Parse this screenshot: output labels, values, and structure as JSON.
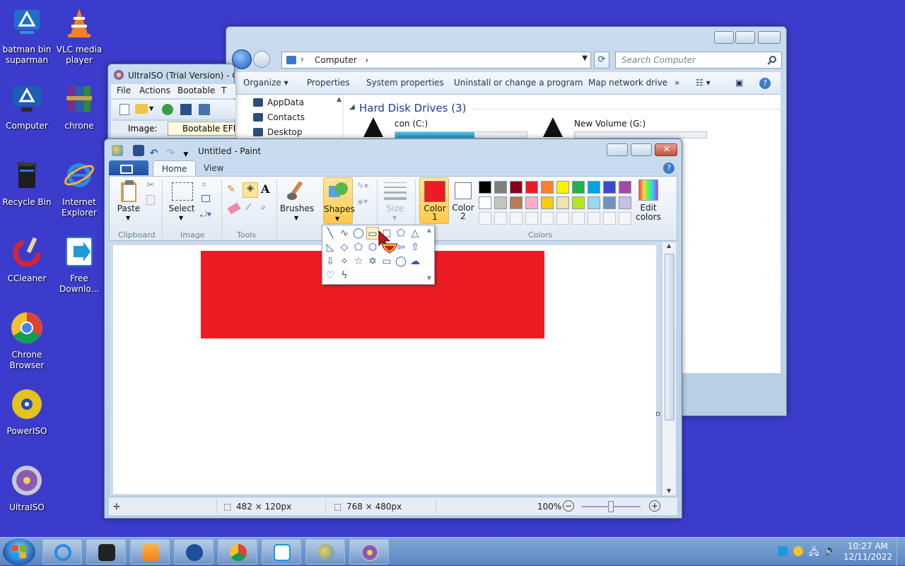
{
  "desktop": {
    "icons": [
      {
        "label": "batman bin\nsuparman",
        "icon": "computer-logo-icon"
      },
      {
        "label": "VLC media\nplayer",
        "icon": "vlc-cone-icon"
      },
      {
        "label": "Computer",
        "icon": "computer-logo-icon"
      },
      {
        "label": "chrone",
        "icon": "winrar-books-icon"
      },
      {
        "label": "Recycle Bin",
        "icon": "recycle-bin-icon"
      },
      {
        "label": "Internet\nExplorer",
        "icon": "internet-explorer-icon"
      },
      {
        "label": "CCleaner",
        "icon": "ccleaner-icon"
      },
      {
        "label": "Free\nDownlo...",
        "icon": "free-download-icon"
      },
      {
        "label": "Chrone\nBrowser",
        "icon": "chrome-icon"
      },
      {
        "label": "PowerISO",
        "icon": "poweriso-disc-icon"
      },
      {
        "label": "UltraISO",
        "icon": "ultraiso-disc-icon"
      }
    ]
  },
  "explorer": {
    "address": "Computer",
    "search_placeholder": "Search Computer",
    "toolbar": [
      "Organize",
      "Properties",
      "System properties",
      "Uninstall or change a program",
      "Map network drive",
      "»"
    ],
    "nav_items": [
      "AppData",
      "Contacts",
      "Desktop"
    ],
    "section_title": "Hard Disk Drives (3)",
    "drives": [
      {
        "name": "con (C:)",
        "fill": 0.6
      },
      {
        "name": "New Volume (G:)",
        "fill": 0.0
      }
    ]
  },
  "ultraiso": {
    "title": "UltraISO (Trial Version) - C",
    "menu": [
      "File",
      "Actions",
      "Bootable",
      "T"
    ],
    "image_label": "Image:",
    "image_value": "Bootable EFI"
  },
  "paint": {
    "title": "Untitled - Paint",
    "tabs": [
      "Home",
      "View"
    ],
    "groups": [
      "Clipboard",
      "Image",
      "Tools",
      "Colors"
    ],
    "buttons": {
      "paste": "Paste",
      "select": "Select",
      "brushes": "Brushes",
      "shapes": "Shapes",
      "size": "Size",
      "color1": "Color\n1",
      "color2": "Color\n2",
      "edit_colors": "Edit\ncolors"
    },
    "palette": [
      "#000000",
      "#7f7f7f",
      "#880015",
      "#ed1c24",
      "#ff7f27",
      "#fff200",
      "#22b14c",
      "#00a2e8",
      "#3f48cc",
      "#a349a4",
      "#ffffff",
      "#c3c3c3",
      "#b97a57",
      "#ffaec9",
      "#ffc90e",
      "#efe4b0",
      "#b5e61d",
      "#99d9ea",
      "#7092be",
      "#c8bfe7"
    ],
    "color1": "#ed1c24",
    "color2": "#ffffff",
    "rect_color": "#ed1c24",
    "status": {
      "selection_size": "482 × 120px",
      "canvas_size": "768 × 480px",
      "zoom": "100%",
      "zoom_level": 0.5
    }
  },
  "taskbar": {
    "clock_time": "10:27 AM",
    "clock_date": "12/11/2022"
  }
}
